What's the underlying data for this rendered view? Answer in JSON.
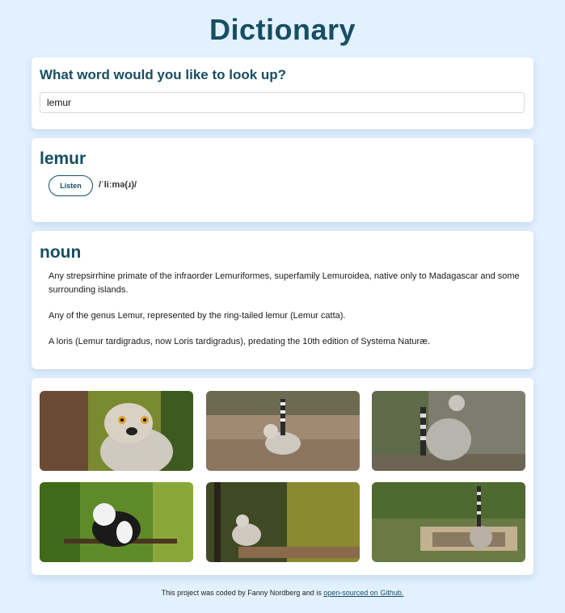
{
  "app": {
    "title": "Dictionary"
  },
  "search": {
    "heading": "What word would you like to look up?",
    "value": "lemur"
  },
  "result": {
    "word": "lemur",
    "listen_label": "Listen",
    "phonetic": "/ˈliːmə(ɹ)/"
  },
  "meaning": {
    "part_of_speech": "noun",
    "definitions": [
      "Any strepsirrhine primate of the infraorder Lemuriformes, superfamily Lemuroidea, native only to Madagascar and some surrounding islands.",
      "Any of the genus Lemur, represented by the ring-tailed lemur (Lemur catta).",
      "A loris (Lemur tardigradus, now Loris tardigradus), predating the 10th edition of Systema Naturæ."
    ]
  },
  "photos": [
    {
      "icon": "lemur-photo-icon",
      "colors": {
        "bg": "#6a5a3a",
        "accent": "#d9d2c4"
      }
    },
    {
      "icon": "lemur-photo-icon",
      "colors": {
        "bg": "#9a8570",
        "accent": "#cfc8bf"
      }
    },
    {
      "icon": "lemur-photo-icon",
      "colors": {
        "bg": "#7c7d6e",
        "accent": "#b7b4ad"
      }
    },
    {
      "icon": "lemur-photo-icon",
      "colors": {
        "bg": "#5f8a2a",
        "accent": "#1a1a1a"
      }
    },
    {
      "icon": "lemur-photo-icon",
      "colors": {
        "bg": "#4f5a2a",
        "accent": "#cfc8bf"
      }
    },
    {
      "icon": "lemur-photo-icon",
      "colors": {
        "bg": "#6a7a45",
        "accent": "#b8b0a6"
      }
    }
  ],
  "footer": {
    "text": "This project was coded by Fanny Nordberg and is ",
    "link_label": "open-sourced on Github."
  },
  "colors": {
    "accent": "#164e63",
    "page_bg": "#e3f1ff",
    "card_bg": "#ffffff"
  }
}
